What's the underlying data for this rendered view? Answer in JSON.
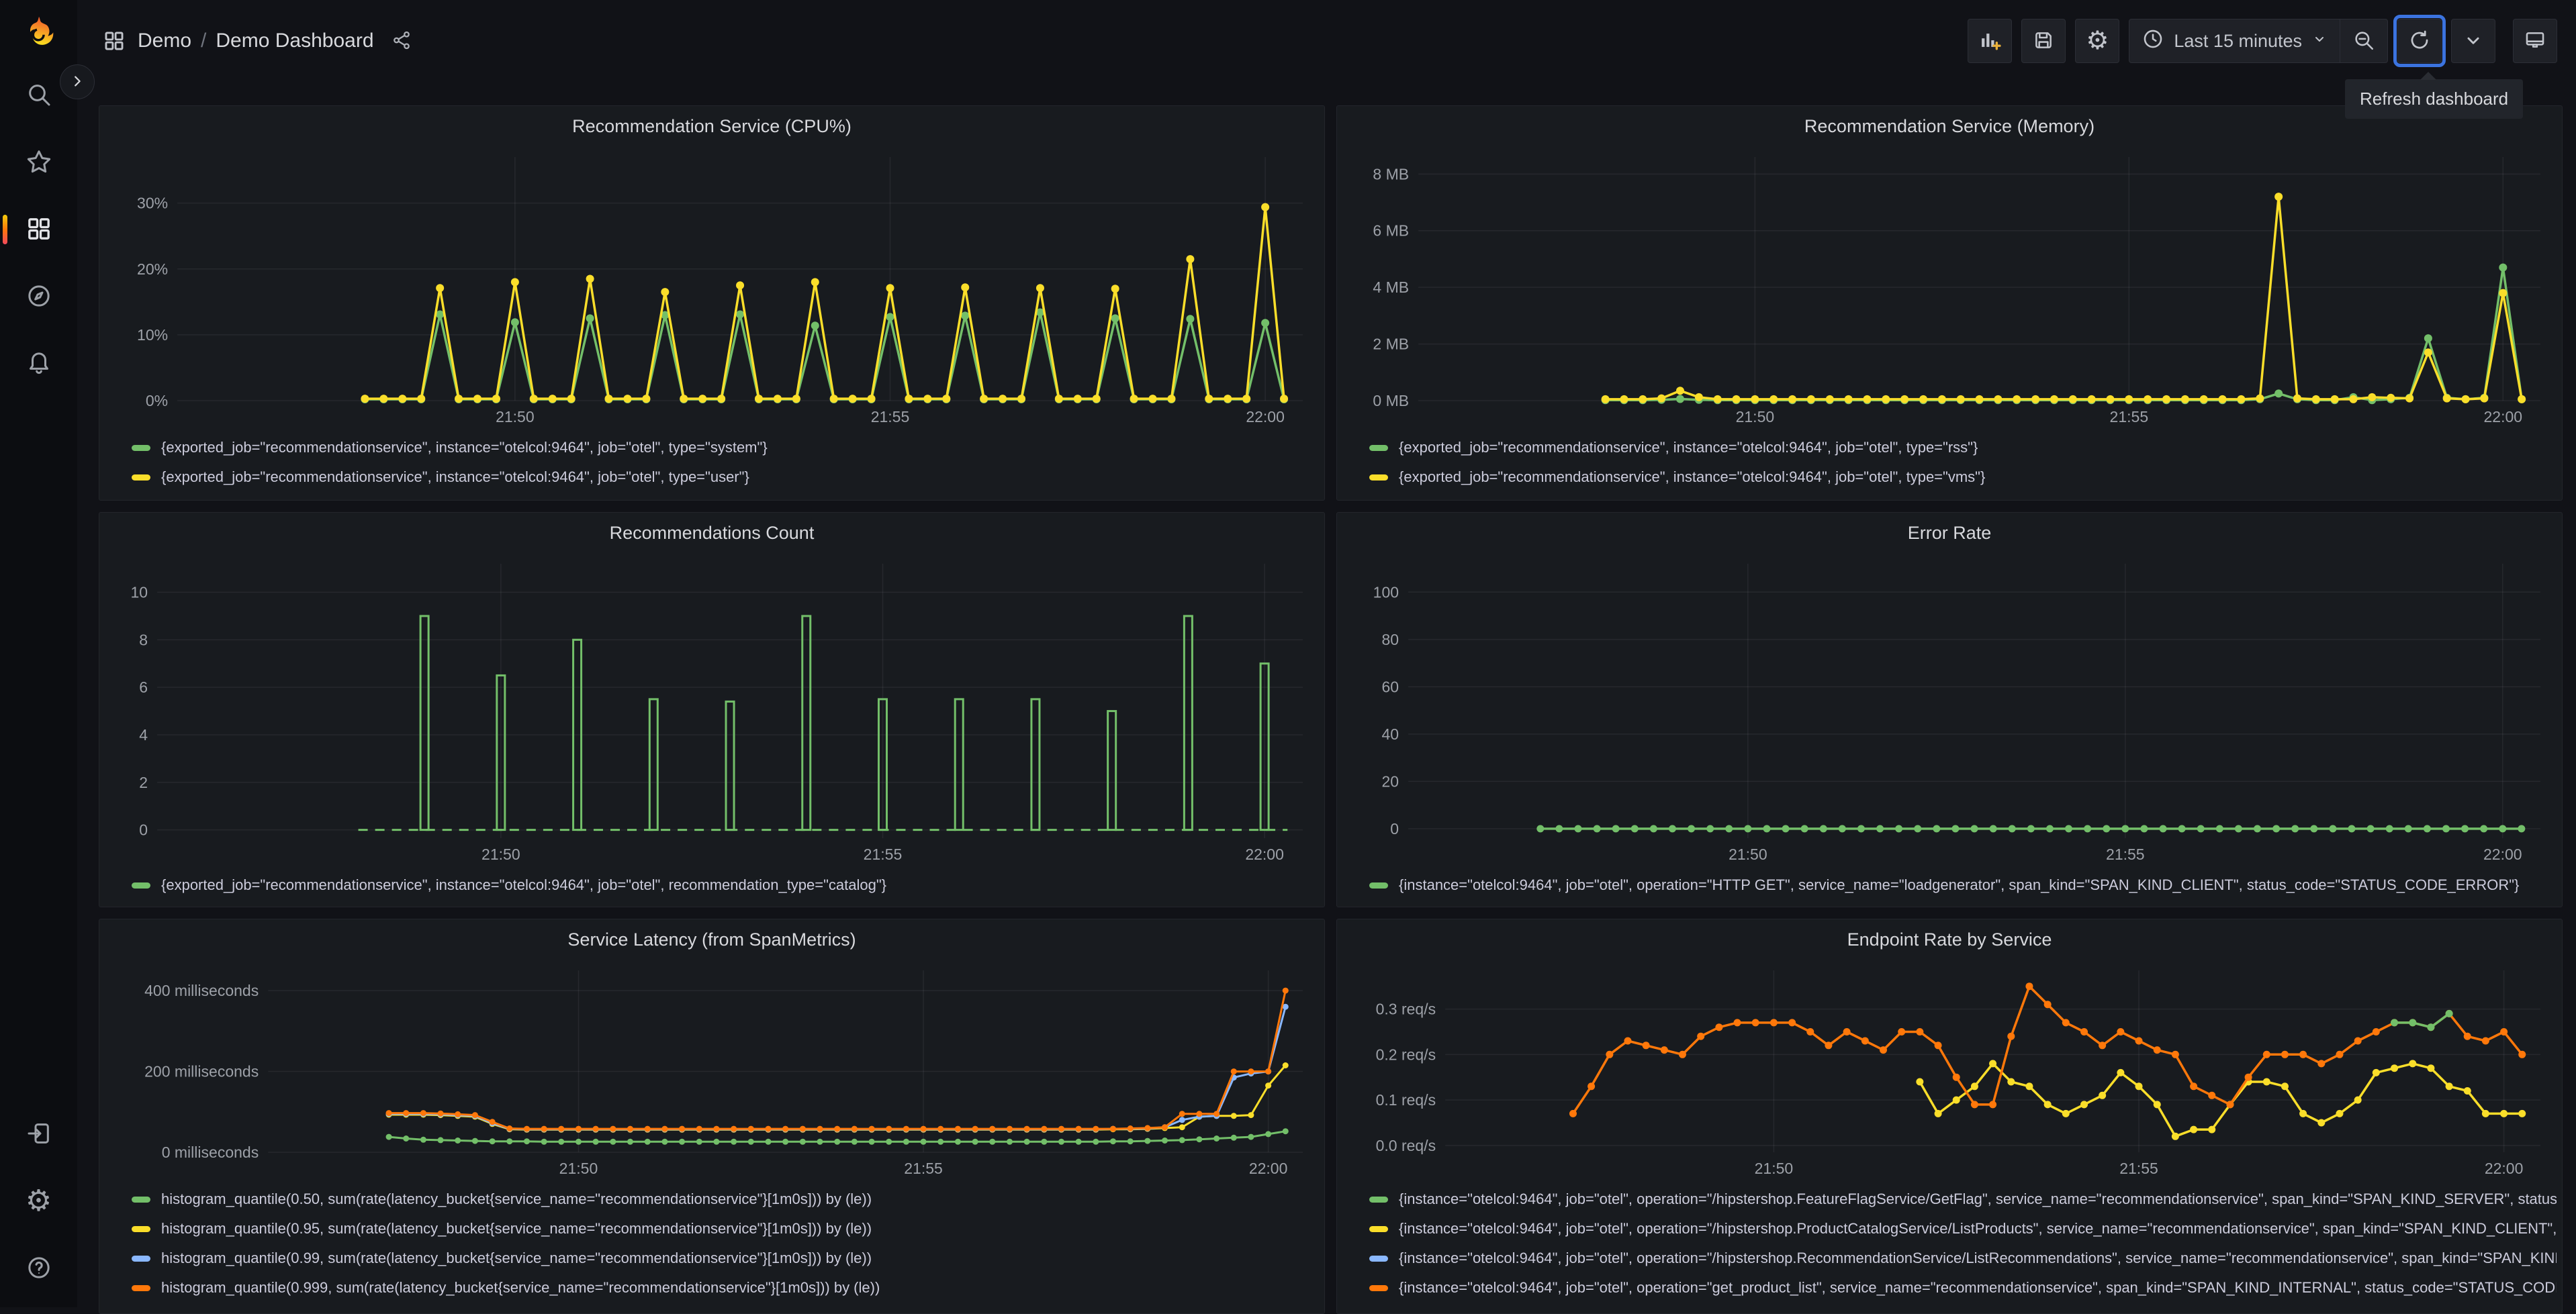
{
  "nav": {
    "breadcrumb": {
      "section": "Demo",
      "separator": "/",
      "page": "Demo Dashboard"
    },
    "time_label": "Last 15 minutes",
    "tooltip": "Refresh dashboard",
    "toolbar_buttons": [
      "add-panel",
      "save-dashboard",
      "dashboard-settings",
      "time-range-picker",
      "zoom-out-time-range",
      "refresh-dashboard",
      "refresh-interval",
      "cycle-view-mode"
    ]
  },
  "sidebar": {
    "items": [
      "search",
      "favorites",
      "dashboards",
      "explore",
      "alerting"
    ],
    "active_item": "dashboards",
    "bottom_items": [
      "sign-in",
      "configuration",
      "help"
    ]
  },
  "colors": {
    "green": "#73BF69",
    "yellow": "#FADE2A",
    "blue": "#8AB8FF",
    "orange": "#FF780A",
    "focus_blue": "#3B73DF",
    "background": "#111217",
    "panel": "#181B1F",
    "text": "#CCCCDC"
  },
  "time_axis": {
    "window": "21:45:30 - 22:00:30",
    "domain_seconds": [
      0,
      900
    ]
  },
  "panels": [
    {
      "title": "Recommendation Service (CPU%)",
      "type": "line",
      "ylim": [
        0,
        37
      ],
      "y_ticks": [
        {
          "v": 0,
          "label": "0%"
        },
        {
          "v": 10,
          "label": "10%"
        },
        {
          "v": 20,
          "label": "20%"
        },
        {
          "v": 30,
          "label": "30%"
        }
      ],
      "x_ticks": [
        {
          "t": 270,
          "label": "21:50"
        },
        {
          "t": 570,
          "label": "21:55"
        },
        {
          "t": 870,
          "label": "22:00"
        }
      ],
      "series": [
        {
          "label": "{exported_job=\"recommendationservice\", instance=\"otelcol:9464\", job=\"otel\", type=\"system\"}",
          "color": "#73BF69",
          "t0": 150,
          "dt": 15,
          "values": [
            0.2,
            0.2,
            0.2,
            0.2,
            13.1,
            0.2,
            0.2,
            0.2,
            11.9,
            0.2,
            0.2,
            0.2,
            12.5,
            0.2,
            0.2,
            0.2,
            13.0,
            0.2,
            0.2,
            0.2,
            13.1,
            0.2,
            0.2,
            0.2,
            11.4,
            0.2,
            0.2,
            0.2,
            12.7,
            0.2,
            0.2,
            0.2,
            12.9,
            0.2,
            0.2,
            0.2,
            13.4,
            0.2,
            0.2,
            0.2,
            12.5,
            0.2,
            0.2,
            0.2,
            12.4,
            0.2,
            0.2,
            0.2,
            11.8,
            0.2
          ]
        },
        {
          "label": "{exported_job=\"recommendationservice\", instance=\"otelcol:9464\", job=\"otel\", type=\"user\"}",
          "color": "#FADE2A",
          "t0": 150,
          "dt": 15,
          "values": [
            0.3,
            0.3,
            0.3,
            0.3,
            17.1,
            0.3,
            0.3,
            0.3,
            18.0,
            0.3,
            0.3,
            0.3,
            18.5,
            0.3,
            0.3,
            0.3,
            16.5,
            0.3,
            0.3,
            0.3,
            17.5,
            0.3,
            0.3,
            0.3,
            18.0,
            0.3,
            0.3,
            0.3,
            17.1,
            0.3,
            0.3,
            0.3,
            17.2,
            0.3,
            0.3,
            0.3,
            17.1,
            0.3,
            0.3,
            0.3,
            17.0,
            0.3,
            0.3,
            0.3,
            21.5,
            0.3,
            0.3,
            0.3,
            29.4,
            0.3
          ]
        }
      ]
    },
    {
      "title": "Recommendation Service (Memory)",
      "type": "line",
      "ylim": [
        0,
        8.6
      ],
      "y_ticks": [
        {
          "v": 0,
          "label": "0 MB"
        },
        {
          "v": 2,
          "label": "2 MB"
        },
        {
          "v": 4,
          "label": "4 MB"
        },
        {
          "v": 6,
          "label": "6 MB"
        },
        {
          "v": 8,
          "label": "8 MB"
        }
      ],
      "x_ticks": [
        {
          "t": 270,
          "label": "21:50"
        },
        {
          "t": 570,
          "label": "21:55"
        },
        {
          "t": 870,
          "label": "22:00"
        }
      ],
      "series": [
        {
          "label": "{exported_job=\"recommendationservice\", instance=\"otelcol:9464\", job=\"otel\", type=\"rss\"}",
          "color": "#73BF69",
          "t0": 150,
          "dt": 15,
          "values": [
            0.02,
            0.02,
            0.02,
            0.03,
            0.06,
            0.03,
            0.02,
            0.02,
            0.02,
            0.02,
            0.02,
            0.02,
            0.02,
            0.02,
            0.02,
            0.02,
            0.02,
            0.02,
            0.02,
            0.02,
            0.02,
            0.02,
            0.02,
            0.02,
            0.02,
            0.02,
            0.02,
            0.02,
            0.02,
            0.02,
            0.02,
            0.02,
            0.02,
            0.02,
            0.02,
            0.05,
            0.25,
            0.05,
            0.02,
            0.02,
            0.12,
            0.02,
            0.05,
            0.1,
            2.2,
            0.1,
            0.05,
            0.1,
            4.7,
            0.05
          ]
        },
        {
          "label": "{exported_job=\"recommendationservice\", instance=\"otelcol:9464\", job=\"otel\", type=\"vms\"}",
          "color": "#FADE2A",
          "t0": 150,
          "dt": 15,
          "values": [
            0.05,
            0.05,
            0.05,
            0.08,
            0.35,
            0.12,
            0.05,
            0.05,
            0.05,
            0.05,
            0.05,
            0.05,
            0.05,
            0.05,
            0.05,
            0.05,
            0.05,
            0.05,
            0.05,
            0.05,
            0.05,
            0.05,
            0.05,
            0.05,
            0.05,
            0.05,
            0.05,
            0.05,
            0.05,
            0.05,
            0.05,
            0.05,
            0.05,
            0.05,
            0.05,
            0.08,
            7.2,
            0.08,
            0.05,
            0.05,
            0.05,
            0.12,
            0.1,
            0.08,
            1.7,
            0.08,
            0.05,
            0.08,
            3.8,
            0.05
          ]
        }
      ]
    },
    {
      "title": "Recommendations Count",
      "type": "pulse",
      "ylim": [
        -0.35,
        11.2
      ],
      "y_ticks": [
        {
          "v": 0,
          "label": "0"
        },
        {
          "v": 2,
          "label": "2"
        },
        {
          "v": 4,
          "label": "4"
        },
        {
          "v": 6,
          "label": "6"
        },
        {
          "v": 8,
          "label": "8"
        },
        {
          "v": 10,
          "label": "10"
        }
      ],
      "x_ticks": [
        {
          "t": 270,
          "label": "21:50"
        },
        {
          "t": 570,
          "label": "21:55"
        },
        {
          "t": 870,
          "label": "22:00"
        }
      ],
      "series": [
        {
          "label": "{exported_job=\"recommendationservice\", instance=\"otelcol:9464\", job=\"otel\", recommendation_type=\"catalog\"}",
          "color": "#73BF69",
          "type": "pulse",
          "baseline": [
            158,
            888
          ],
          "points": [
            [
              210,
              9
            ],
            [
              270,
              6.5
            ],
            [
              330,
              8
            ],
            [
              390,
              5.5
            ],
            [
              450,
              5.4
            ],
            [
              510,
              9
            ],
            [
              570,
              5.5
            ],
            [
              630,
              5.5
            ],
            [
              690,
              5.5
            ],
            [
              750,
              5
            ],
            [
              810,
              9
            ],
            [
              870,
              7
            ]
          ]
        }
      ]
    },
    {
      "title": "Error Rate",
      "type": "line",
      "ylim": [
        -4,
        112
      ],
      "y_ticks": [
        {
          "v": 0,
          "label": "0"
        },
        {
          "v": 20,
          "label": "20"
        },
        {
          "v": 40,
          "label": "40"
        },
        {
          "v": 60,
          "label": "60"
        },
        {
          "v": 80,
          "label": "80"
        },
        {
          "v": 100,
          "label": "100"
        }
      ],
      "x_ticks": [
        {
          "t": 270,
          "label": "21:50"
        },
        {
          "t": 570,
          "label": "21:55"
        },
        {
          "t": 870,
          "label": "22:00"
        }
      ],
      "series": [
        {
          "label": "{instance=\"otelcol:9464\", job=\"otel\", operation=\"HTTP GET\", service_name=\"loadgenerator\", span_kind=\"SPAN_KIND_CLIENT\", status_code=\"STATUS_CODE_ERROR\"}",
          "color": "#73BF69",
          "t0": 105,
          "dt": 15,
          "values": [
            0,
            0,
            0,
            0,
            0,
            0,
            0,
            0,
            0,
            0,
            0,
            0,
            0,
            0,
            0,
            0,
            0,
            0,
            0,
            0,
            0,
            0,
            0,
            0,
            0,
            0,
            0,
            0,
            0,
            0,
            0,
            0,
            0,
            0,
            0,
            0,
            0,
            0,
            0,
            0,
            0,
            0,
            0,
            0,
            0,
            0,
            0,
            0,
            0,
            0,
            0,
            0,
            0
          ]
        }
      ]
    },
    {
      "title": "Service Latency (from SpanMetrics)",
      "type": "line",
      "ylim": [
        0,
        450
      ],
      "y_ticks": [
        {
          "v": 0,
          "label": "0 milliseconds"
        },
        {
          "v": 200,
          "label": "200 milliseconds"
        },
        {
          "v": 400,
          "label": "400 milliseconds"
        }
      ],
      "x_ticks": [
        {
          "t": 270,
          "label": "21:50"
        },
        {
          "t": 570,
          "label": "21:55"
        },
        {
          "t": 870,
          "label": "22:00"
        }
      ],
      "series": [
        {
          "label": "histogram_quantile(0.50, sum(rate(latency_bucket{service_name=\"recommendationservice\"}[1m0s])) by (le))",
          "color": "#73BF69",
          "t0": 105,
          "dt": 15,
          "values": [
            38,
            34,
            31,
            30,
            29,
            28,
            27,
            27,
            27,
            26,
            26,
            26,
            26,
            26,
            26,
            26,
            26,
            26,
            26,
            26,
            26,
            26,
            26,
            26,
            26,
            26,
            26,
            26,
            26,
            26,
            26,
            26,
            26,
            26,
            26,
            26,
            26,
            26,
            26,
            26,
            26,
            26,
            27,
            27,
            28,
            29,
            30,
            32,
            34,
            36,
            38,
            45,
            52
          ]
        },
        {
          "label": "histogram_quantile(0.95, sum(rate(latency_bucket{service_name=\"recommendationservice\"}[1m0s])) by (le))",
          "color": "#FADE2A",
          "t0": 105,
          "dt": 15,
          "values": [
            93,
            93,
            93,
            92,
            90,
            88,
            70,
            57,
            56,
            56,
            56,
            56,
            56,
            56,
            56,
            56,
            56,
            56,
            56,
            56,
            56,
            56,
            56,
            56,
            56,
            56,
            56,
            56,
            56,
            56,
            56,
            56,
            56,
            56,
            56,
            56,
            56,
            56,
            56,
            56,
            56,
            56,
            57,
            57,
            58,
            60,
            62,
            88,
            90,
            90,
            92,
            165,
            215
          ]
        },
        {
          "label": "histogram_quantile(0.99, sum(rate(latency_bucket{service_name=\"recommendationservice\"}[1m0s])) by (le))",
          "color": "#8AB8FF",
          "t0": 105,
          "dt": 15,
          "values": [
            95,
            95,
            95,
            94,
            92,
            90,
            72,
            58,
            57,
            57,
            57,
            57,
            57,
            57,
            57,
            57,
            57,
            57,
            57,
            57,
            57,
            57,
            57,
            57,
            57,
            57,
            57,
            57,
            57,
            57,
            57,
            57,
            57,
            57,
            57,
            57,
            57,
            57,
            57,
            57,
            57,
            57,
            58,
            58,
            59,
            62,
            80,
            88,
            90,
            185,
            195,
            200,
            360
          ]
        },
        {
          "label": "histogram_quantile(0.999, sum(rate(latency_bucket{service_name=\"recommendationservice\"}[1m0s])) by (le))",
          "color": "#FF780A",
          "t0": 105,
          "dt": 15,
          "values": [
            97,
            97,
            97,
            96,
            94,
            92,
            75,
            59,
            58,
            58,
            58,
            58,
            58,
            58,
            58,
            58,
            58,
            58,
            58,
            58,
            58,
            58,
            58,
            58,
            58,
            58,
            58,
            58,
            58,
            58,
            58,
            58,
            58,
            58,
            58,
            58,
            58,
            58,
            58,
            58,
            58,
            58,
            58,
            59,
            60,
            62,
            95,
            95,
            95,
            200,
            200,
            200,
            400
          ]
        }
      ]
    },
    {
      "title": "Endpoint Rate by Service",
      "type": "line",
      "ylim": [
        -0.015,
        0.385
      ],
      "y_ticks": [
        {
          "v": 0,
          "label": "0.0 req/s"
        },
        {
          "v": 0.1,
          "label": "0.1 req/s"
        },
        {
          "v": 0.2,
          "label": "0.2 req/s"
        },
        {
          "v": 0.3,
          "label": "0.3 req/s"
        }
      ],
      "x_ticks": [
        {
          "t": 270,
          "label": "21:50"
        },
        {
          "t": 570,
          "label": "21:55"
        },
        {
          "t": 870,
          "label": "22:00"
        }
      ],
      "series": [
        {
          "label": "{instance=\"otelcol:9464\", job=\"otel\", operation=\"/hipstershop.FeatureFlagService/GetFlag\", service_name=\"recommendationservice\", span_kind=\"SPAN_KIND_SERVER\", status_code=\"STATUS_CODE_UNSET\"}",
          "color": "#73BF69",
          "t0": 780,
          "dt": 15,
          "z": 3,
          "values": [
            0.27,
            0.27,
            0.26,
            0.29
          ]
        },
        {
          "label": "{instance=\"otelcol:9464\", job=\"otel\", operation=\"/hipstershop.ProductCatalogService/ListProducts\", service_name=\"recommendationservice\", span_kind=\"SPAN_KIND_CLIENT\", status_code=\"STATUS_CODE_UNSET\"}",
          "color": "#FADE2A",
          "t0": 390,
          "dt": 15,
          "z": 1,
          "values": [
            0.14,
            0.07,
            0.1,
            0.13,
            0.18,
            0.14,
            0.13,
            0.09,
            0.07,
            0.09,
            0.11,
            0.16,
            0.13,
            0.09,
            0.02,
            0.035,
            0.035,
            0.09,
            0.14,
            0.14,
            0.13,
            0.07,
            0.05,
            0.07,
            0.1,
            0.16,
            0.17,
            0.18,
            0.17,
            0.13,
            0.12,
            0.07,
            0.07,
            0.07
          ]
        },
        {
          "label": "{instance=\"otelcol:9464\", job=\"otel\", operation=\"/hipstershop.RecommendationService/ListRecommendations\", service_name=\"recommendationservice\", span_kind=\"SPAN_KIND_SERVER\", status_code=\"STATUS_CODE_UNSET\"}",
          "color": "#8AB8FF",
          "t0": 780,
          "dt": 15,
          "z": 0,
          "values": []
        },
        {
          "label": "{instance=\"otelcol:9464\", job=\"otel\", operation=\"get_product_list\", service_name=\"recommendationservice\", span_kind=\"SPAN_KIND_INTERNAL\", status_code=\"STATUS_CODE_UNSET\"}",
          "color": "#FF780A",
          "t0": 105,
          "dt": 15,
          "z": 2,
          "values": [
            0.07,
            0.13,
            0.2,
            0.23,
            0.22,
            0.21,
            0.2,
            0.24,
            0.26,
            0.27,
            0.27,
            0.27,
            0.27,
            0.25,
            0.22,
            0.25,
            0.23,
            0.21,
            0.25,
            0.25,
            0.22,
            0.15,
            0.09,
            0.09,
            0.24,
            0.35,
            0.31,
            0.27,
            0.25,
            0.22,
            0.25,
            0.23,
            0.21,
            0.2,
            0.13,
            0.11,
            0.09,
            0.15,
            0.2,
            0.2,
            0.2,
            0.18,
            0.2,
            0.23,
            0.25,
            0.27,
            0.27,
            0.26,
            0.29,
            0.24,
            0.23,
            0.25,
            0.2
          ]
        }
      ]
    }
  ]
}
